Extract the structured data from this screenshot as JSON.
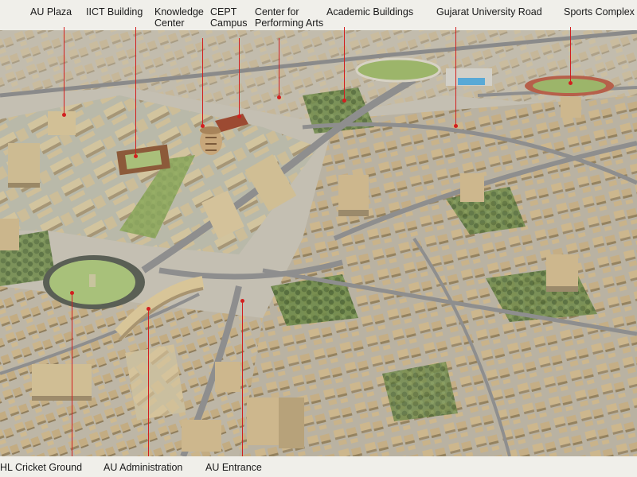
{
  "image": {
    "kind": "aerial 3D master plan rendering",
    "colors": {
      "label_text": "#1a1a1a",
      "leader_line": "#d21f1f",
      "building": "#c9b48a",
      "building_shadow": "#9d8b6b",
      "road": "#8a8a8a",
      "trees": "#5d7a3e",
      "grass": "#9bb46a",
      "band": "#f5f4f0"
    }
  },
  "labels": {
    "au_plaza": "AU Plaza",
    "iict_building": "IICT Building",
    "knowledge_center_1": "Knowledge",
    "knowledge_center_2": "Center",
    "cept_campus_1": "CEPT",
    "cept_campus_2": "Campus",
    "performing_arts_1": "Center for",
    "performing_arts_2": "Performing Arts",
    "academic_buildings": "Academic Buildings",
    "gujarat_university_road": "Gujarat University Road",
    "sports_complex": "Sports Complex",
    "hl_cricket_ground": "HL Cricket Ground",
    "au_administration": "AU Administration",
    "au_entrance": "AU Entrance"
  }
}
